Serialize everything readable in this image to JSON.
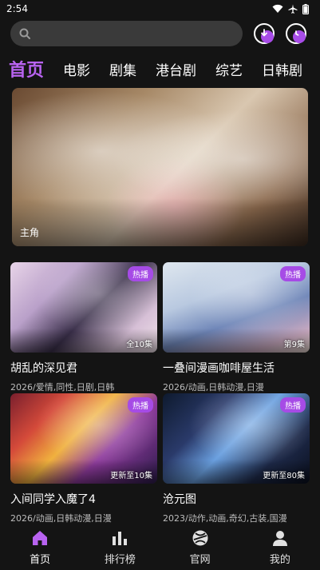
{
  "status": {
    "time": "2:54"
  },
  "search": {
    "placeholder": ""
  },
  "tabs": [
    "首页",
    "电影",
    "剧集",
    "港台剧",
    "综艺",
    "日韩剧"
  ],
  "banner": {
    "label": "主角"
  },
  "cards": [
    {
      "title": "胡乱的深见君",
      "meta": "2026/爱情,同性,日剧,日韩",
      "badge": "热播",
      "episode": "全10集"
    },
    {
      "title": "一叠间漫画咖啡屋生活",
      "meta": "2026/动画,日韩动漫,日漫",
      "badge": "热播",
      "episode": "第9集"
    },
    {
      "title": "入间同学入魔了4",
      "meta": "2026/动画,日韩动漫,日漫",
      "badge": "热播",
      "episode": "更新至10集"
    },
    {
      "title": "沧元图",
      "meta": "2023/动作,动画,奇幻,古装,国漫",
      "badge": "热播",
      "episode": "更新至80集"
    }
  ],
  "nav": [
    {
      "label": "首页",
      "icon": "home-icon"
    },
    {
      "label": "排行榜",
      "icon": "bar-chart-icon"
    },
    {
      "label": "官网",
      "icon": "globe-icon"
    },
    {
      "label": "我的",
      "icon": "user-icon"
    }
  ],
  "colors": {
    "accent": "#b863f0",
    "badge": "#a64be6",
    "background": "#141414"
  }
}
